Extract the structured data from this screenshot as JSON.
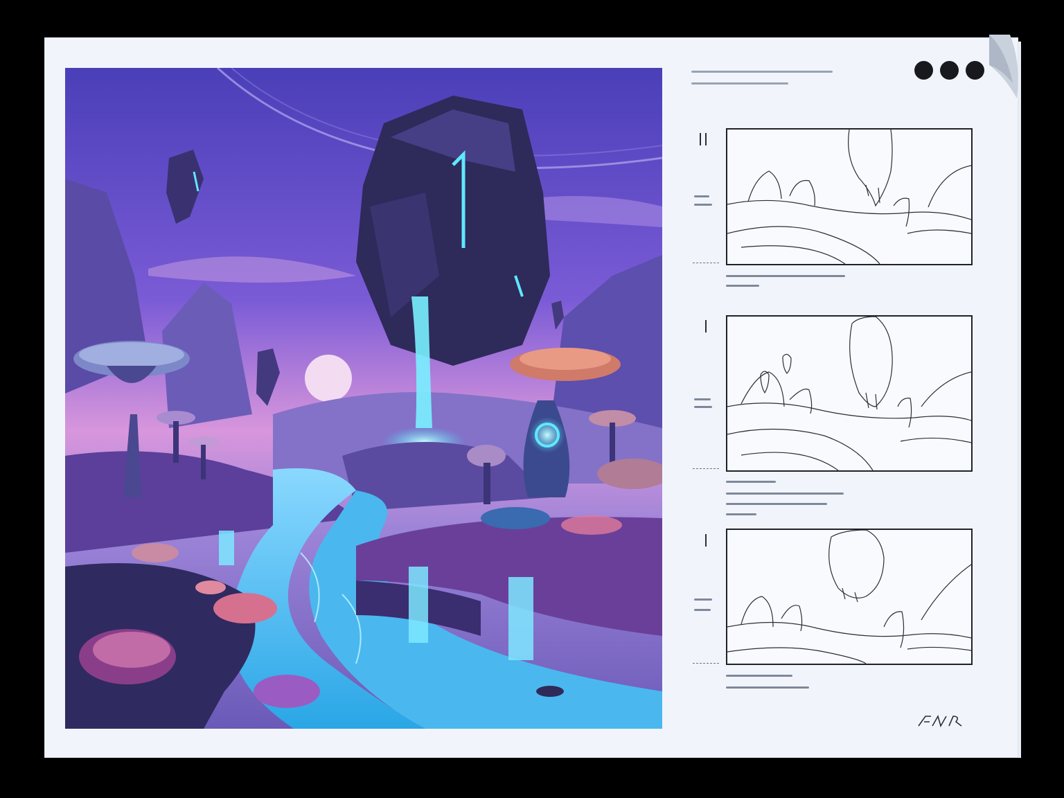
{
  "sheet": {
    "paper_color": "#f1f5fb",
    "ink_color": "#1f2329",
    "palette": {
      "sky_top": "#5b47c9",
      "sky_horizon": "#e0a2dc",
      "river_glow": "#5fe8ff",
      "foliage_pink": "#e07a9a",
      "rock_dark": "#2e2a55"
    }
  },
  "illustration": {
    "subject": "floating-glowing-rock-over-river",
    "icon": "landscape-illustration"
  },
  "header_dots": {
    "count": 3,
    "icon": "menu-dots-icon"
  },
  "storyboard": {
    "panels": [
      {
        "id": 1,
        "icon": "storyboard-sketch-wide"
      },
      {
        "id": 2,
        "icon": "storyboard-sketch-mid"
      },
      {
        "id": 3,
        "icon": "storyboard-sketch-close"
      }
    ]
  },
  "signature": {
    "icon": "handwritten-signature"
  }
}
